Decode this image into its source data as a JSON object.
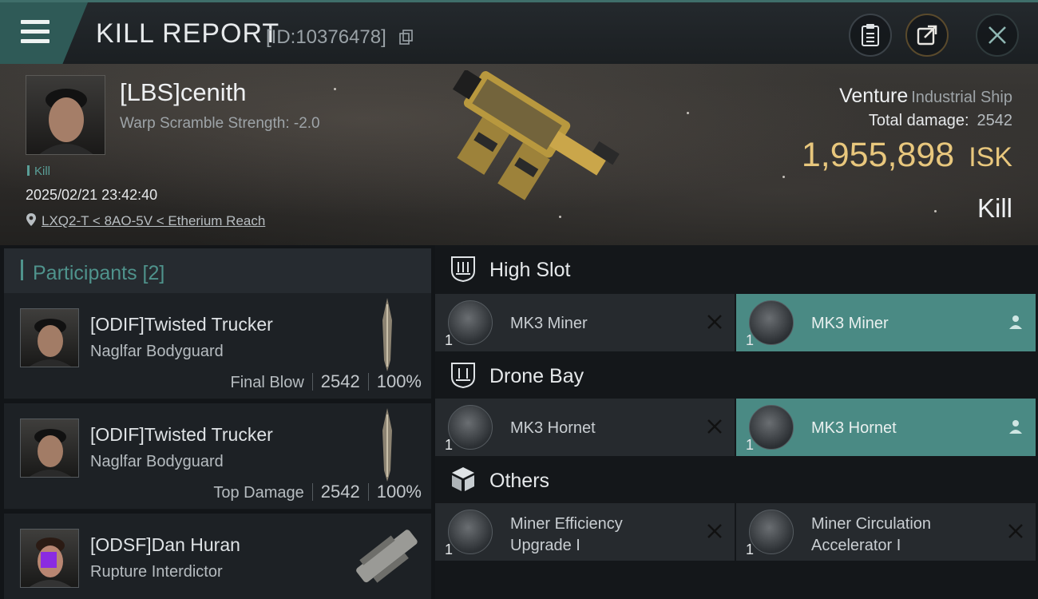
{
  "header": {
    "title": "KILL REPORT",
    "report_id": "[ID:10376478]"
  },
  "victim": {
    "name": "[LBS]cenith",
    "warp_scramble": "Warp Scramble Strength: -2.0",
    "tag": "Kill",
    "datetime": "2025/02/21 23:42:40",
    "location": "LXQ2-T < 8AO-5V < Etherium Reach",
    "ship_name": "Venture",
    "ship_class": "Industrial Ship",
    "total_damage_label": "Total damage:",
    "total_damage": "2542",
    "isk_value": "1,955,898",
    "isk_unit": "ISK",
    "result": "Kill"
  },
  "participants": {
    "header": "Participants [2]",
    "items": [
      {
        "name": "[ODIF]Twisted Trucker",
        "ship": "Naglfar Bodyguard",
        "stat_label": "Final Blow",
        "damage": "2542",
        "percent": "100%"
      },
      {
        "name": "[ODIF]Twisted Trucker",
        "ship": "Naglfar Bodyguard",
        "stat_label": "Top Damage",
        "damage": "2542",
        "percent": "100%"
      },
      {
        "name": "[ODSF]Dan Huran",
        "ship": "Rupture Interdictor"
      }
    ]
  },
  "sections": {
    "high_slot": {
      "label": "High Slot",
      "modules": [
        {
          "name": "MK3 Miner",
          "qty": "1",
          "status": "destroyed"
        },
        {
          "name": "MK3 Miner",
          "qty": "1",
          "status": "dropped"
        }
      ]
    },
    "drone_bay": {
      "label": "Drone Bay",
      "modules": [
        {
          "name": "MK3  Hornet",
          "qty": "1",
          "status": "destroyed"
        },
        {
          "name": "MK3  Hornet",
          "qty": "1",
          "status": "dropped"
        }
      ]
    },
    "others": {
      "label": "Others",
      "modules": [
        {
          "name": "Miner Efficiency Upgrade I",
          "qty": "1",
          "status": "destroyed"
        },
        {
          "name": "Miner Circulation Accelerator I",
          "qty": "1",
          "status": "destroyed"
        }
      ]
    }
  },
  "colors": {
    "accent_teal": "#4a8a84",
    "isk_gold": "#e8c77d"
  }
}
